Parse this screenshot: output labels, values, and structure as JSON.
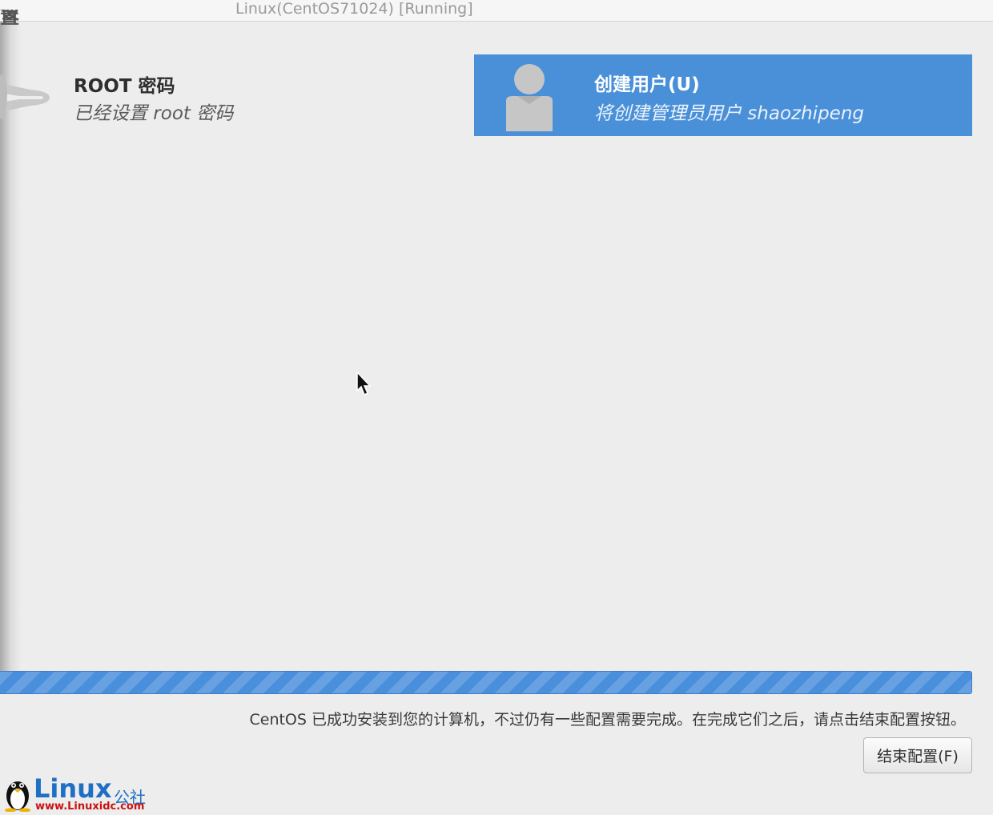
{
  "window": {
    "title": "Linux(CentOS71024) [Running]",
    "corner_fragment": "设置"
  },
  "settings": {
    "root": {
      "title": "ROOT 密码",
      "status": "已经设置 root 密码",
      "icon": "key-icon"
    },
    "user": {
      "title": "创建用户(U)",
      "status": "将创建管理员用户 shaozhipeng",
      "icon": "user-avatar-icon",
      "selected": true
    }
  },
  "progress": {
    "value_percent": 100
  },
  "footer": {
    "message": "CentOS 已成功安装到您的计算机，不过仍有一些配置需要完成。在完成它们之后，请点击结束配置按钮。",
    "finish_button": "结束配置(F)"
  },
  "watermark": {
    "brand": "Linux",
    "suffix": "公社",
    "url": "www.Linuxidc.com"
  },
  "colors": {
    "accent": "#4a90d9",
    "background": "#ededed",
    "progress": "#4a8fdc",
    "watermark_blue": "#1f6fc4",
    "watermark_red": "#cc1111"
  }
}
